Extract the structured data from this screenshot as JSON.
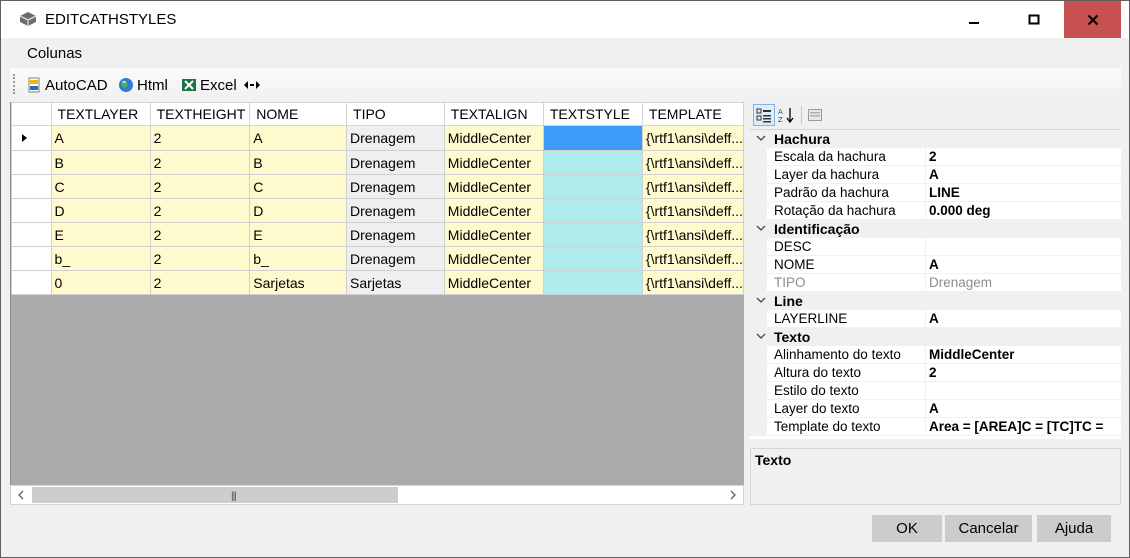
{
  "window": {
    "title": "EDITCATHSTYLES",
    "controls": {
      "minimize": "minimize-icon",
      "maximize": "maximize-icon",
      "close": "close-icon"
    }
  },
  "menu": {
    "items": [
      "Colunas"
    ]
  },
  "toolbar": {
    "buttons": [
      {
        "label": "AutoCAD",
        "icon": "autocad-icon"
      },
      {
        "label": "Html",
        "icon": "globe-icon"
      },
      {
        "label": "Excel",
        "icon": "excel-icon"
      },
      {
        "label": "",
        "icon": "swap-arrows-icon"
      }
    ]
  },
  "grid": {
    "columns": [
      "TEXTLAYER",
      "TEXTHEIGHT",
      "NOME",
      "TIPO",
      "TEXTALIGN",
      "TEXTSTYLE",
      "TEMPLATE"
    ],
    "rows": [
      [
        "A",
        "2",
        "A",
        "Drenagem",
        "MiddleCenter",
        "",
        "{\\rtf1\\ansi\\deff..."
      ],
      [
        "B",
        "2",
        "B",
        "Drenagem",
        "MiddleCenter",
        "",
        "{\\rtf1\\ansi\\deff..."
      ],
      [
        "C",
        "2",
        "C",
        "Drenagem",
        "MiddleCenter",
        "",
        "{\\rtf1\\ansi\\deff..."
      ],
      [
        "D",
        "2",
        "D",
        "Drenagem",
        "MiddleCenter",
        "",
        "{\\rtf1\\ansi\\deff..."
      ],
      [
        "E",
        "2",
        "E",
        "Drenagem",
        "MiddleCenter",
        "",
        "{\\rtf1\\ansi\\deff..."
      ],
      [
        "b_",
        "2",
        "b_",
        "Drenagem",
        "MiddleCenter",
        "",
        "{\\rtf1\\ansi\\deff..."
      ],
      [
        "0",
        "2",
        "Sarjetas",
        "Sarjetas",
        "MiddleCenter",
        "",
        "{\\rtf1\\ansi\\deff..."
      ]
    ],
    "current_row": 0,
    "colors": {
      "editable": "#fffacd",
      "readonly": "#efefef",
      "style": "#b0ecec",
      "selected": "#3e9af8"
    }
  },
  "property_grid": {
    "toolbar_icons": [
      "categorized-icon",
      "alphabetical-icon",
      "property-pages-icon"
    ],
    "categories": [
      {
        "name": "Hachura",
        "props": [
          {
            "name": "Escala da hachura",
            "value": "2"
          },
          {
            "name": "Layer da hachura",
            "value": "A"
          },
          {
            "name": "Padrão da hachura",
            "value": "LINE"
          },
          {
            "name": "Rotação da hachura",
            "value": "0.000 deg"
          }
        ]
      },
      {
        "name": "Identificação",
        "props": [
          {
            "name": "DESC",
            "value": ""
          },
          {
            "name": "NOME",
            "value": "A"
          },
          {
            "name": "TIPO",
            "value": "Drenagem",
            "readonly": true
          }
        ]
      },
      {
        "name": "Line",
        "props": [
          {
            "name": "LAYERLINE",
            "value": "A"
          }
        ]
      },
      {
        "name": "Texto",
        "props": [
          {
            "name": "Alinhamento do texto",
            "value": "MiddleCenter"
          },
          {
            "name": "Altura do texto",
            "value": "2"
          },
          {
            "name": "Estilo do texto",
            "value": ""
          },
          {
            "name": "Layer do texto",
            "value": "A"
          },
          {
            "name": "Template do texto",
            "value": "Area = [AREA]C = [TC]TC ="
          }
        ]
      }
    ],
    "description_title": "Texto"
  },
  "footer": {
    "ok": "OK",
    "cancel": "Cancelar",
    "help": "Ajuda"
  }
}
